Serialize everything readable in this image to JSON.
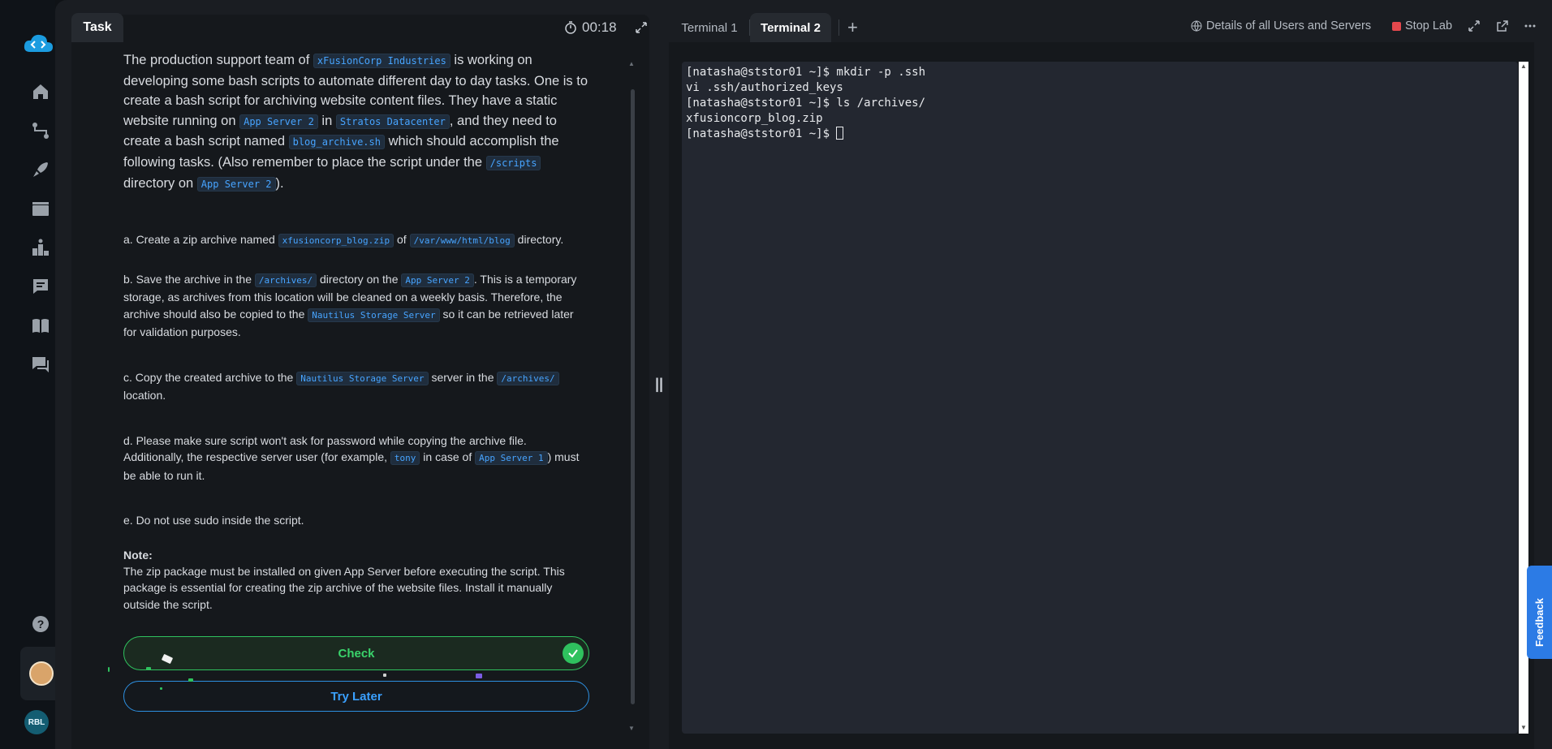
{
  "task_panel": {
    "tab_label": "Task",
    "timer": "00:18",
    "intro": {
      "t1": "The production support team of ",
      "c1": "xFusionCorp Industries",
      "t2": " is working on developing some bash scripts to automate different day to day tasks. One is to create a bash script for archiving website content files. They have a static website running on ",
      "c2": "App Server 2",
      "t3": " in ",
      "c3": "Stratos Datacenter",
      "t4": ", and they need to create a bash script named ",
      "c4": "blog_archive.sh",
      "t5": " which should accomplish the following tasks. (Also remember to place the script under the ",
      "c5": "/scripts",
      "t6": " directory on ",
      "c6": "App Server 2",
      "t7": ")."
    },
    "item_a": {
      "t1": "a. Create a zip archive named ",
      "c1": "xfusioncorp_blog.zip",
      "t2": " of ",
      "c2": "/var/www/html/blog",
      "t3": " directory."
    },
    "item_b": {
      "t1": "b. Save the archive in the ",
      "c1": "/archives/",
      "t2": " directory on the ",
      "c2": "App Server 2",
      "t3": ". This is a temporary storage, as archives from this location will be cleaned on a weekly basis. Therefore, the archive should also be copied to the ",
      "c3": "Nautilus Storage Server",
      "t4": " so it can be retrieved later for validation purposes."
    },
    "item_c": {
      "t1": "c. Copy the created archive to the ",
      "c1": "Nautilus Storage Server",
      "t2": " server in the ",
      "c2": "/archives/",
      "t3": " location."
    },
    "item_d": {
      "t1": "d. Please make sure script won't ask for password while copying the archive file. Additionally, the respective server user (for example, ",
      "c1": "tony",
      "t2": " in case of ",
      "c2": "App Server 1",
      "t3": ") must be able to run it."
    },
    "item_e": "e. Do not use sudo inside the script.",
    "note_title": "Note:",
    "note_body": "The zip package must be installed on given App Server before executing the script. This package is essential for creating the zip archive of the website files. Install it manually outside the script.",
    "check_label": "Check",
    "later_label": "Try Later"
  },
  "terminal_header": {
    "tabs": [
      "Terminal 1",
      "Terminal 2"
    ],
    "active_tab": "Terminal 2",
    "details_label": "Details of all Users and Servers",
    "stop_label": "Stop Lab"
  },
  "terminal": {
    "lines": [
      "[natasha@ststor01 ~]$ mkdir -p .ssh",
      "vi .ssh/authorized_keys",
      "[natasha@ststor01 ~]$ ls /archives/",
      "xfusioncorp_blog.zip"
    ],
    "prompt": "[natasha@ststor01 ~]$ "
  },
  "sidebar": {
    "org_initials": "RBL"
  },
  "feedback_label": "Feedback",
  "colors": {
    "accent_blue": "#2c7be5",
    "check_green": "#2fc15e",
    "stop_red": "#e5484d",
    "code_blue": "#47a4ff"
  }
}
